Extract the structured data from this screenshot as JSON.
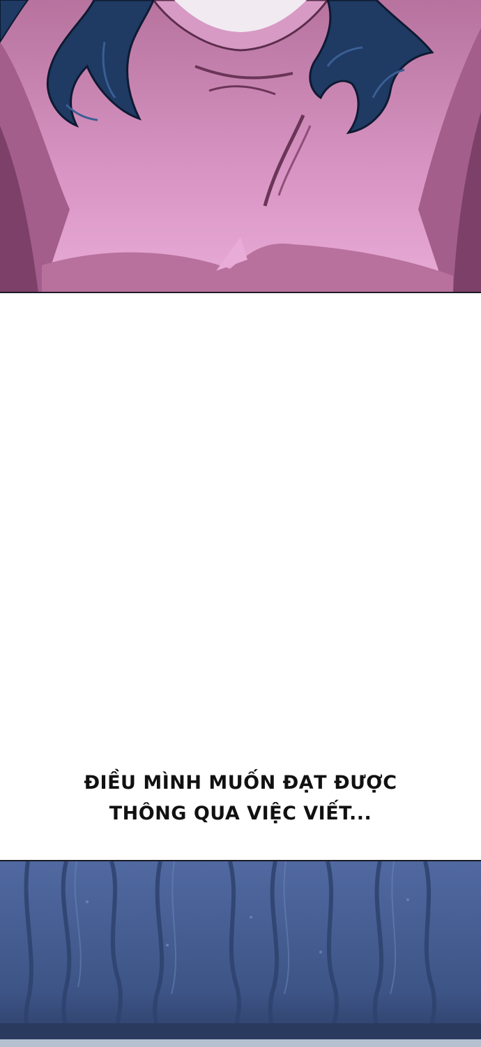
{
  "caption": {
    "line1": "ĐIỀU MÌNH MUỐN ĐẠT ĐƯỢC",
    "line2": "THÔNG QUA VIỆC VIẾT..."
  },
  "colors": {
    "shirt_light": "#e7a6d4",
    "shirt_mid": "#c97fb0",
    "shirt_dark": "#8e4f79",
    "hair": "#1f3a63",
    "hair_dark": "#12203b",
    "wall_top": "#4b6491",
    "wall_bottom": "#2c3e66"
  }
}
